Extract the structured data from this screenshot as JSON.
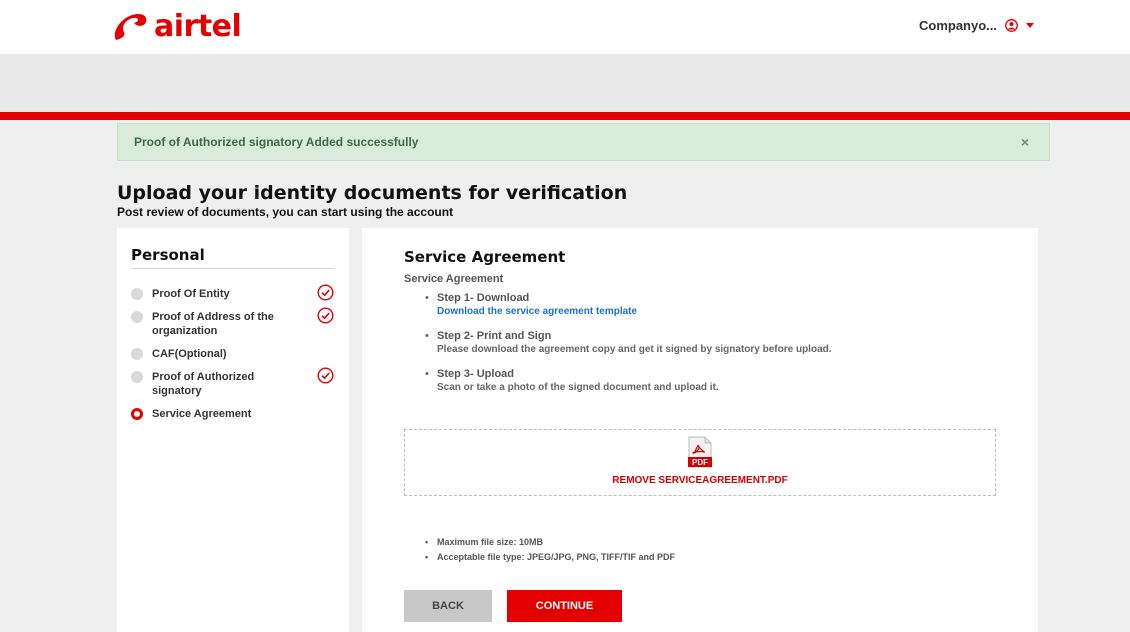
{
  "header": {
    "logo_text": "airtel",
    "account_name": "Companyo...",
    "brand_color": "#e40000"
  },
  "alert": {
    "message": "Proof of Authorized signatory Added successfully",
    "close_label": "×"
  },
  "page": {
    "title": "Upload your identity documents for verification",
    "subtitle": "Post review of documents, you can start using the account"
  },
  "sidebar": {
    "title": "Personal",
    "items": [
      {
        "label": "Proof Of Entity",
        "completed": true,
        "active": false
      },
      {
        "label": "Proof of Address of the organization",
        "completed": true,
        "active": false
      },
      {
        "label": "CAF(Optional)",
        "completed": false,
        "active": false
      },
      {
        "label": "Proof of Authorized signatory",
        "completed": true,
        "active": false
      },
      {
        "label": "Service Agreement",
        "completed": false,
        "active": true
      }
    ]
  },
  "main": {
    "title": "Service Agreement",
    "subtitle": "Service Agreement",
    "steps": [
      {
        "title": "Step 1- Download",
        "link": "Download the service agreement template"
      },
      {
        "title": "Step 2- Print and Sign",
        "desc": "Please download the agreement copy and get it signed by signatory before upload."
      },
      {
        "title": "Step 3- Upload",
        "desc": "Scan or take a photo of the signed document and upload it."
      }
    ],
    "upload": {
      "icon_label": "PDF",
      "remove_label": "REMOVE SERVICEAGREEMENT.PDF"
    },
    "rules": [
      "Maximum file size: 10MB",
      "Acceptable file type: JPEG/JPG, PNG, TIFF/TIF and PDF"
    ],
    "back_label": "BACK",
    "continue_label": "CONTINUE"
  }
}
